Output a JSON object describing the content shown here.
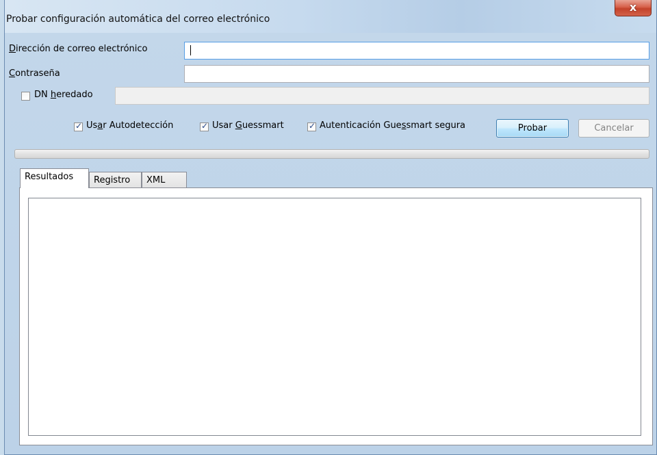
{
  "window": {
    "title": "Probar configuración automática del correo electrónico",
    "close_symbol": "x"
  },
  "fields": {
    "email": {
      "label": "Dirección de correo electrónico",
      "value": ""
    },
    "password": {
      "label": "Contraseña",
      "value": ""
    },
    "legacy_dn": {
      "label": "DN heredado",
      "checked": false,
      "value": ""
    }
  },
  "options": [
    {
      "id": "autodetect",
      "label": "Usar Autodetección",
      "checked": true
    },
    {
      "id": "guessmart",
      "label": "Usar Guessmart",
      "checked": true
    },
    {
      "id": "secure_auth",
      "label": "Autenticación Guessmart segura",
      "checked": true
    }
  ],
  "buttons": {
    "test": "Probar",
    "cancel": "Cancelar"
  },
  "progress": 0,
  "tabs": [
    {
      "label": "Resultados",
      "active": true
    },
    {
      "label": "Registro",
      "active": false
    },
    {
      "label": "XML",
      "active": false
    }
  ],
  "icons": {
    "close": "close-icon",
    "check": "check-icon"
  }
}
